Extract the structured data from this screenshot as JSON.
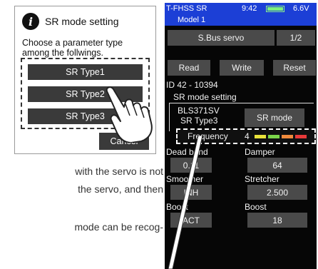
{
  "dialog": {
    "title": "SR mode setting",
    "message_line1": "Choose a parameter type",
    "message_line2": "among the follwings.",
    "options": [
      "SR Type1",
      "SR Type2",
      "SR Type3"
    ],
    "cancel_label": "Cancel",
    "info_glyph": "i"
  },
  "body_text": {
    "line1": "with the servo is not",
    "line2": "the servo, and then",
    "line3": "mode can be recog-"
  },
  "device": {
    "status": {
      "left": "T-FHSS SR",
      "time": "9:42",
      "voltage": "6.6V"
    },
    "model_name": "Model 1",
    "header_button": "S.Bus servo",
    "page": "1/2",
    "actions": [
      "Read",
      "Write",
      "Reset"
    ],
    "id_text": "ID  42  -  10394",
    "sr_group_title": "SR mode setting",
    "servo_name": "BLS371SV",
    "servo_type": "SR Type3",
    "sr_mode_button": "SR mode",
    "frequency_label": "Frequency",
    "frequency_value": "4",
    "frequency_colors": [
      "#e8e23a",
      "#7bd64a",
      "#f08a3c",
      "#e83a3a"
    ],
    "params": [
      {
        "label": "Dead band",
        "value": "0.11"
      },
      {
        "label": "Damper",
        "value": "64"
      },
      {
        "label": "Smoother",
        "value": "INH"
      },
      {
        "label": "Stretcher",
        "value": "2.500"
      },
      {
        "label": "Boost",
        "value": "ACT"
      },
      {
        "label": "Boost",
        "value": "18"
      }
    ]
  },
  "colors": {
    "title_bar": "#1c3fd6",
    "button": "#4a4a4a",
    "dialog_button": "#3a3a3a"
  }
}
